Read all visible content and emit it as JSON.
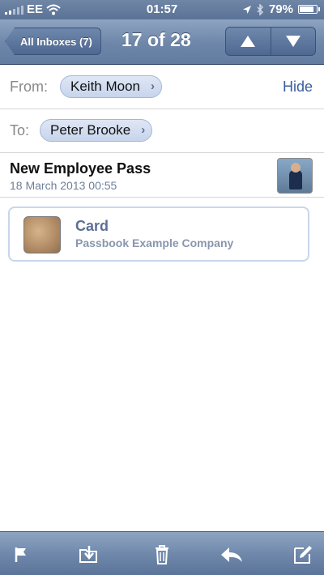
{
  "status_bar": {
    "carrier": "EE",
    "time": "01:57",
    "battery_percent": "79%",
    "battery_level": 0.79
  },
  "nav": {
    "back_label": "All Inboxes (7)",
    "title": "17 of 28",
    "prev_icon": "up-arrow-icon",
    "next_icon": "down-arrow-icon"
  },
  "header": {
    "from_label": "From:",
    "from_name": "Keith Moon",
    "hide_label": "Hide",
    "to_label": "To:",
    "to_name": "Peter Brooke"
  },
  "message": {
    "subject": "New Employee Pass",
    "date": "18 March 2013 00:55"
  },
  "attachment": {
    "title": "Card",
    "subtitle": "Passbook Example Company"
  },
  "toolbar": {
    "icons": [
      "flag-icon",
      "move-folder-icon",
      "trash-icon",
      "reply-icon",
      "compose-icon"
    ]
  },
  "colors": {
    "bar_blue": "#6d86a9",
    "link_blue": "#3b5d9c",
    "pill_bg": "#c7d4ec"
  }
}
